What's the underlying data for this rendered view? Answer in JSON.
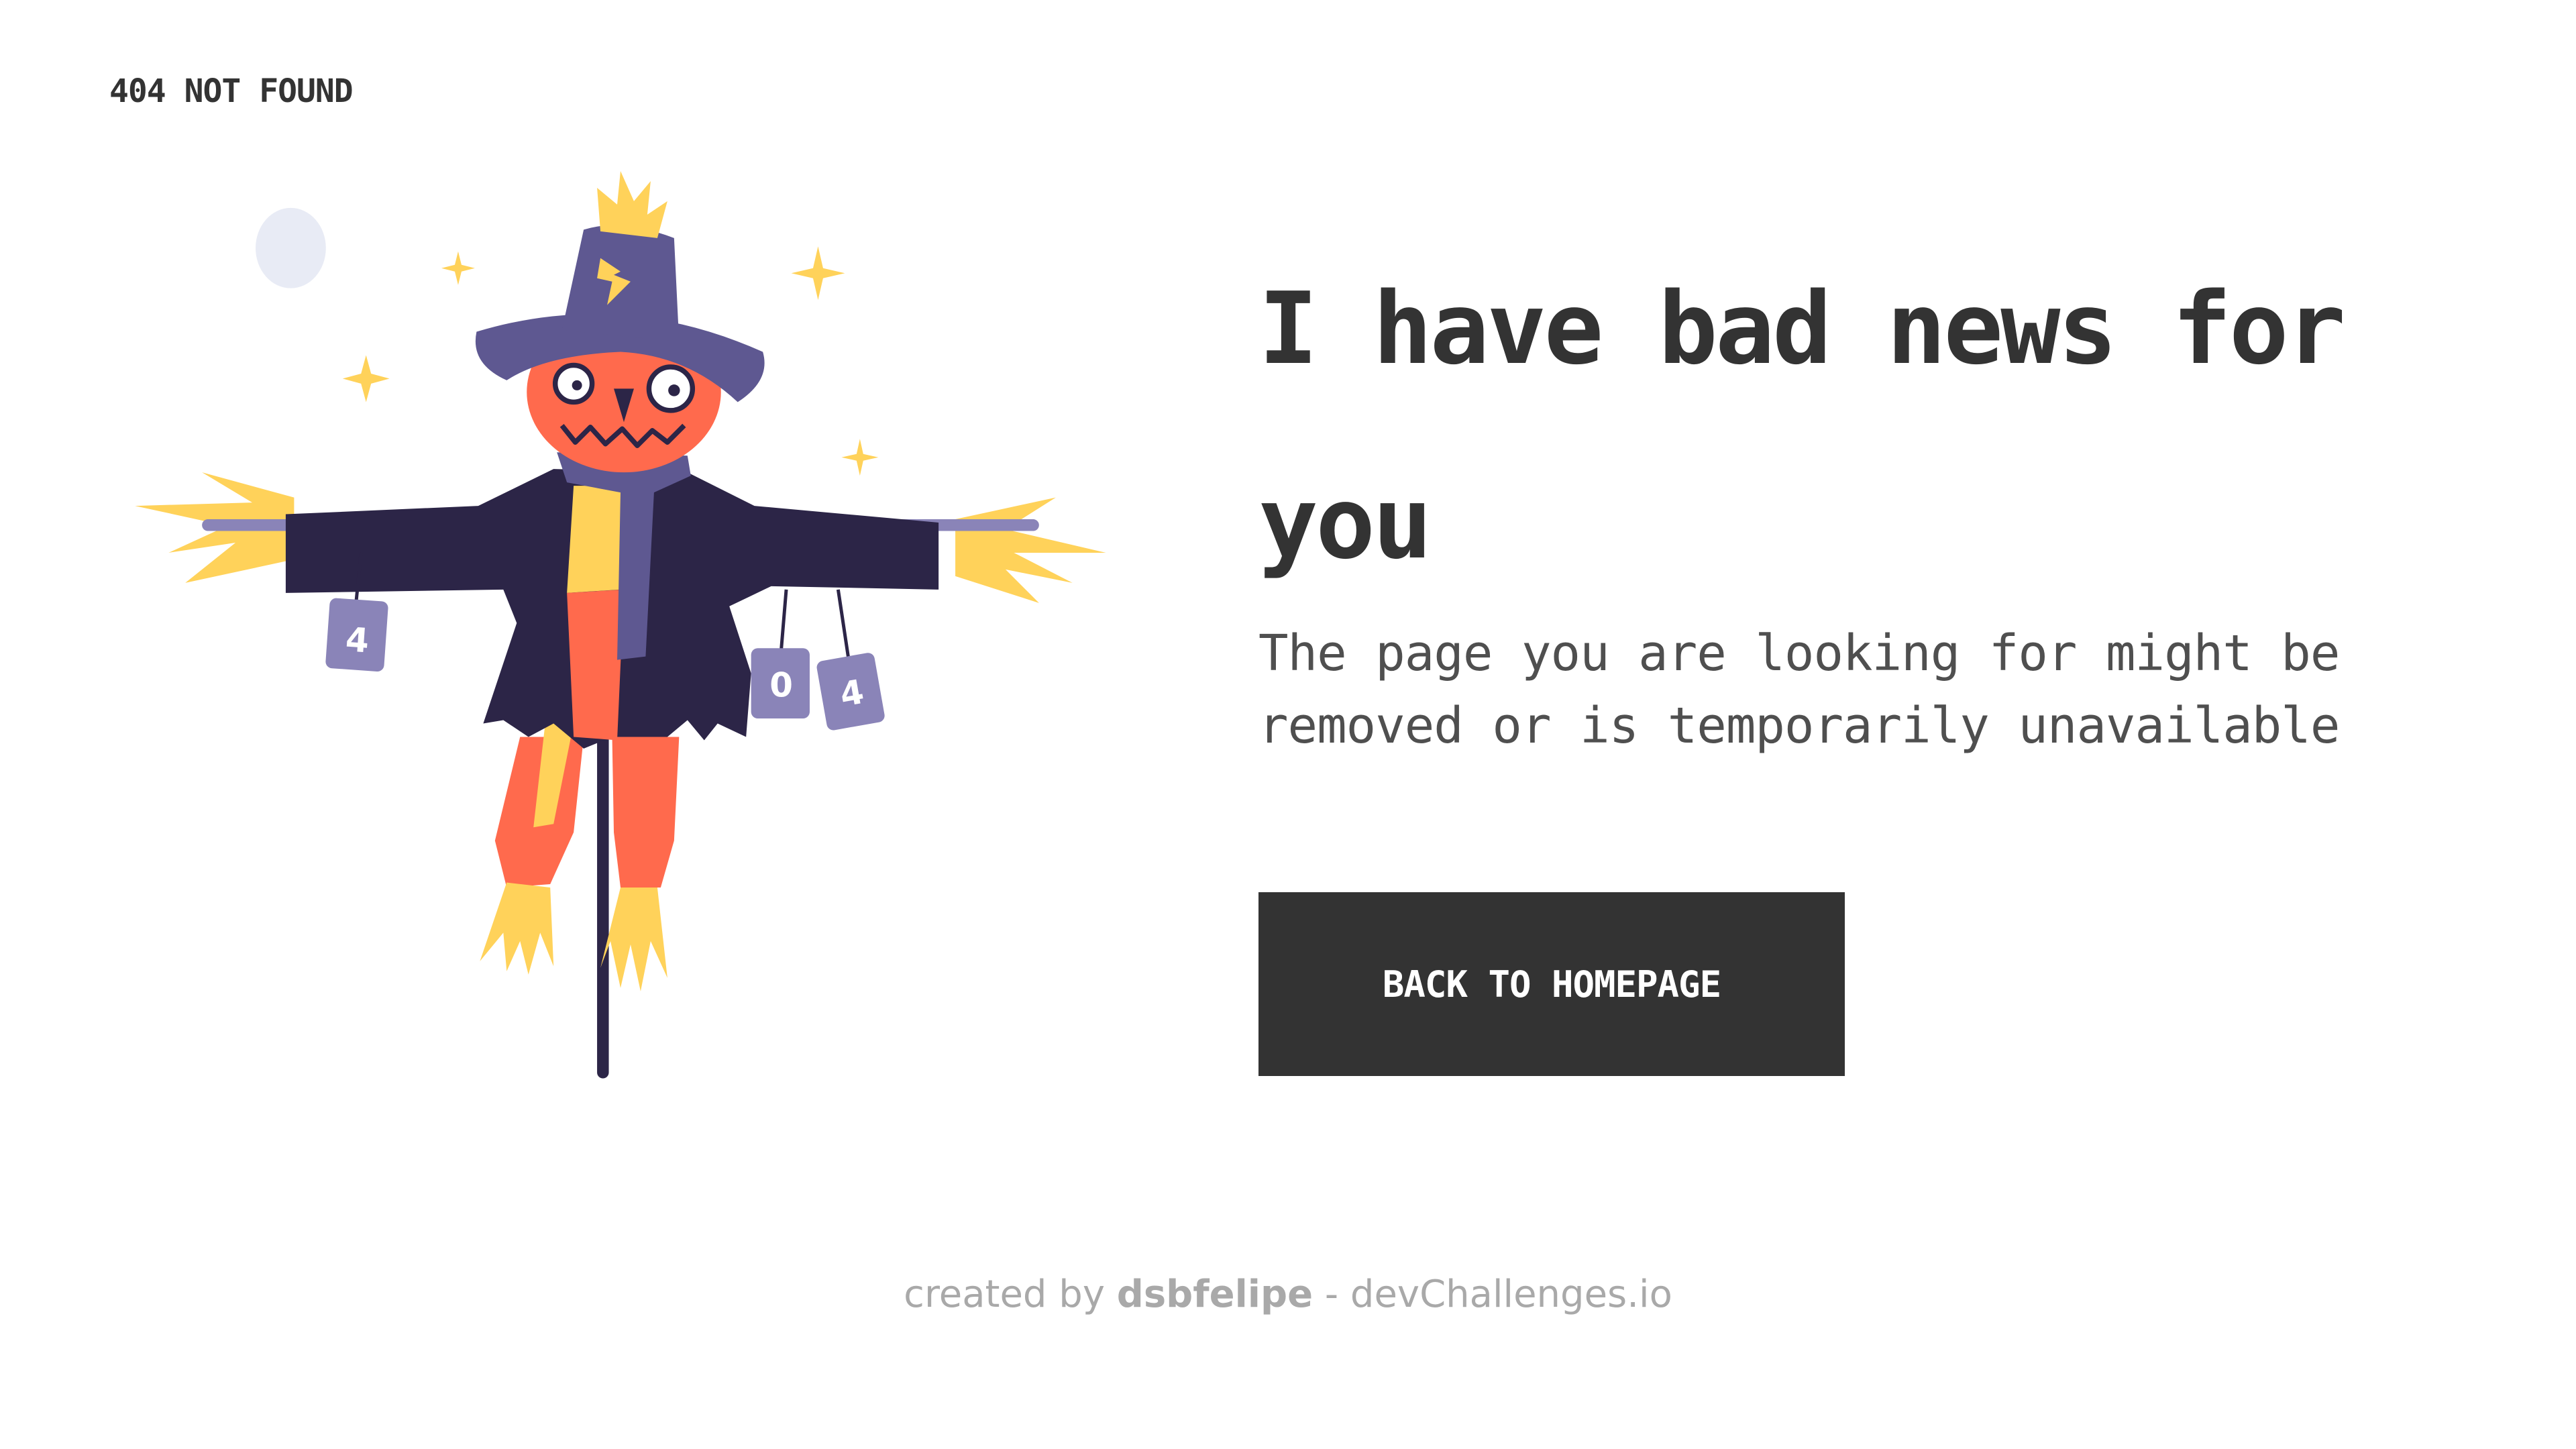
{
  "header": {
    "brand": "404 NOT FOUND"
  },
  "illustration": {
    "name": "scarecrow-illustration",
    "cans": [
      "4",
      "0",
      "4"
    ]
  },
  "main": {
    "headline": "I have bad news for you",
    "description": "The page you are looking for might be removed or is temporarily unavailable",
    "button_label": "BACK TO HOMEPAGE"
  },
  "footer": {
    "prefix": "created by",
    "author": "dsbfelipe",
    "separator": "-",
    "site": "devChallenges.io"
  },
  "colors": {
    "text": "#333333",
    "body_text": "#4f4f4f",
    "button_bg": "#333333",
    "button_text": "#ffffff",
    "footer_text": "#a9a9a9",
    "hat": "#5e5891",
    "coat": "#2c2547",
    "pumpkin": "#ff6a4d",
    "straw": "#ffd25a",
    "moon": "#e8ebf5"
  }
}
